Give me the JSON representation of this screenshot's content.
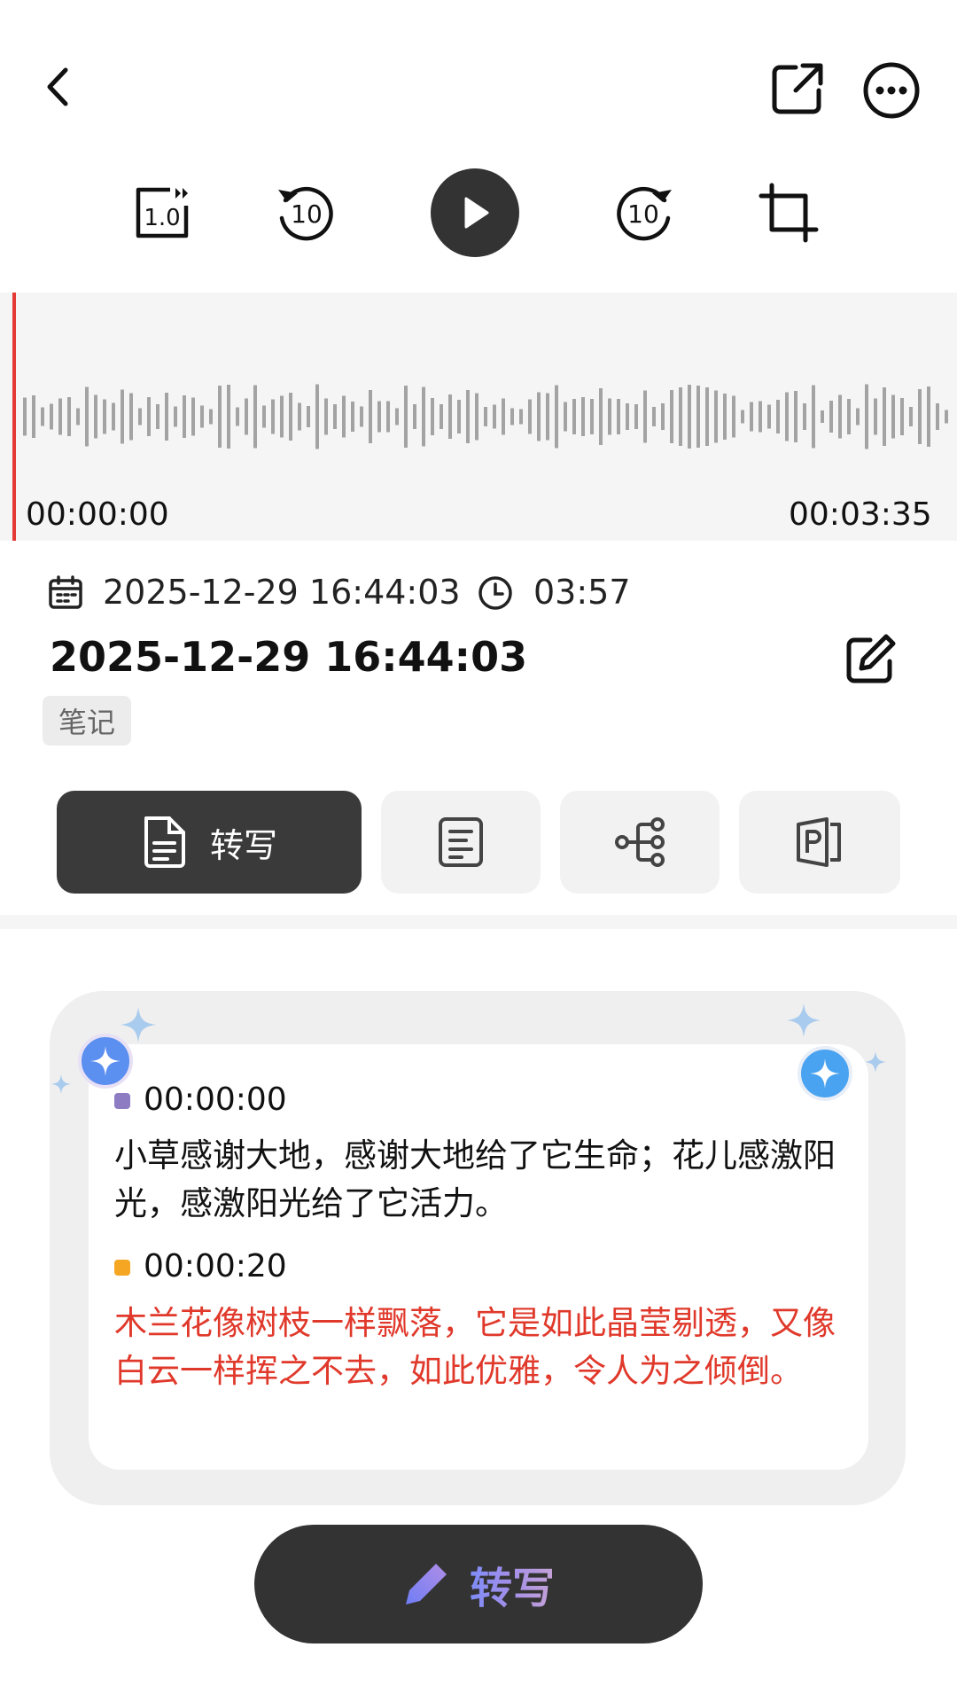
{
  "player": {
    "speed_label": "1.0",
    "rewind_label": "10",
    "forward_label": "10",
    "time_start": "00:00:00",
    "time_end": "00:03:35",
    "playhead_color": "#e53935"
  },
  "meta": {
    "date_time": "2025-12-29 16:44:03",
    "duration": "03:57",
    "title": "2025-12-29 16:44:03",
    "tag": "笔记"
  },
  "tabs": [
    {
      "label": "转写",
      "icon": "document-icon",
      "active": true
    },
    {
      "label": "",
      "icon": "summary-icon",
      "active": false
    },
    {
      "label": "",
      "icon": "mindmap-icon",
      "active": false
    },
    {
      "label": "",
      "icon": "ppt-icon",
      "active": false
    }
  ],
  "transcript": [
    {
      "time": "00:00:00",
      "text": "小草感谢大地，感谢大地给了它生命；花儿感激阳光，感激阳光给了它活力。",
      "color": "#111111",
      "bullet_color": "#8e7cc3"
    },
    {
      "time": "00:00:20",
      "text": "木兰花像树枝一样飘落，它是如此晶莹剔透，又像白云一样挥之不去，如此优雅，令人为之倾倒。",
      "color": "#e0392b",
      "bullet_color": "#f5a623"
    }
  ],
  "bottom_button": {
    "label": "转写",
    "icon": "pencil-icon"
  }
}
